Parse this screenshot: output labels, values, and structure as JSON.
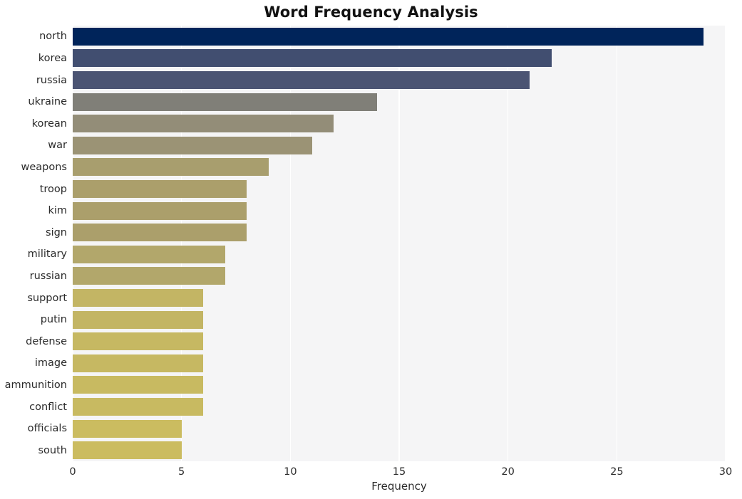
{
  "chart_data": {
    "type": "bar",
    "orientation": "horizontal",
    "title": "Word Frequency Analysis",
    "xlabel": "Frequency",
    "ylabel": "",
    "xlim": [
      0,
      30
    ],
    "ylim": [
      0,
      20
    ],
    "grid": true,
    "legend": null,
    "xticks": [
      "0",
      "5",
      "10",
      "15",
      "20",
      "25",
      "30"
    ],
    "xtick_values": [
      0,
      5,
      10,
      15,
      20,
      25,
      30
    ],
    "categories": [
      "north",
      "korea",
      "russia",
      "ukraine",
      "korean",
      "war",
      "weapons",
      "troop",
      "kim",
      "sign",
      "military",
      "russian",
      "support",
      "putin",
      "defense",
      "image",
      "ammunition",
      "conflict",
      "officials",
      "south"
    ],
    "values": [
      29,
      22,
      21,
      14,
      12,
      11,
      9,
      8,
      8,
      8,
      7,
      7,
      6,
      6,
      6,
      6,
      6,
      6,
      5,
      5
    ],
    "bar_colors": [
      "#00245a",
      "#414e70",
      "#4b5473",
      "#807f78",
      "#938d78",
      "#9b9375",
      "#a89e6e",
      "#ab9f6b",
      "#ab9f6b",
      "#ab9f6b",
      "#b2a76b",
      "#b2a76b",
      "#c3b564",
      "#c3b564",
      "#c6b862",
      "#c6b862",
      "#c8ba61",
      "#c8ba61",
      "#cbbc60",
      "#cbbc60"
    ]
  },
  "figure": {
    "background": "#ffffff",
    "plot_background": "#f5f5f6",
    "gridline_color": "#ffffff",
    "text_color": "#2b2b2b",
    "title_color": "#111111"
  }
}
